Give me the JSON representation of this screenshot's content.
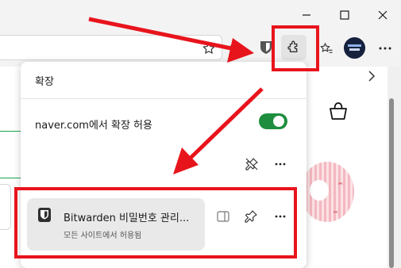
{
  "window": {
    "minimize_icon": "minimize-icon",
    "maximize_icon": "maximize-icon",
    "close_icon": "close-icon"
  },
  "toolbar": {
    "favorite_star_icon": "star-outline-icon",
    "extensions_icon": "puzzle-icon",
    "favorites_icon": "favorites-icon",
    "profile_avatar": "avatar",
    "more_icon": "more-dots-icon"
  },
  "extensions_panel": {
    "title": "확장",
    "site_permission": {
      "label": "naver.com에서 확장 허용",
      "enabled": true,
      "toggle_color": "#1e8e3e"
    },
    "extension": {
      "name": "Bitwarden 비밀번호 관리...",
      "subtitle": "모든 사이트에서 허용됨"
    }
  },
  "annotation": {
    "highlight_color": "#e8141c"
  }
}
